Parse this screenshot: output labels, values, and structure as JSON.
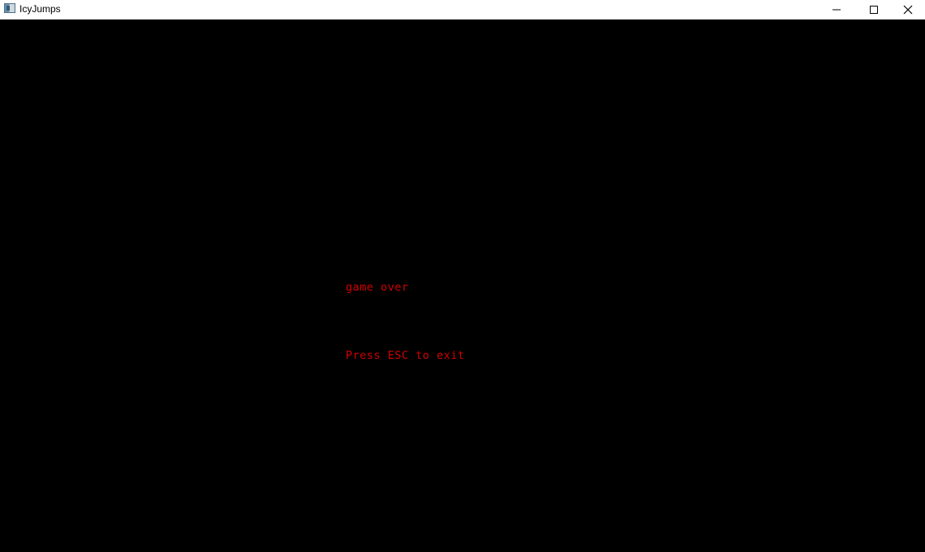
{
  "window": {
    "title": "IcyJumps",
    "controls": {
      "minimize_icon": "minimize-icon",
      "maximize_icon": "maximize-icon",
      "close_icon": "close-icon"
    }
  },
  "game": {
    "background_color": "#000000",
    "text_color": "#d40000",
    "game_over_text": "game over",
    "exit_hint_text": "Press ESC to exit"
  }
}
